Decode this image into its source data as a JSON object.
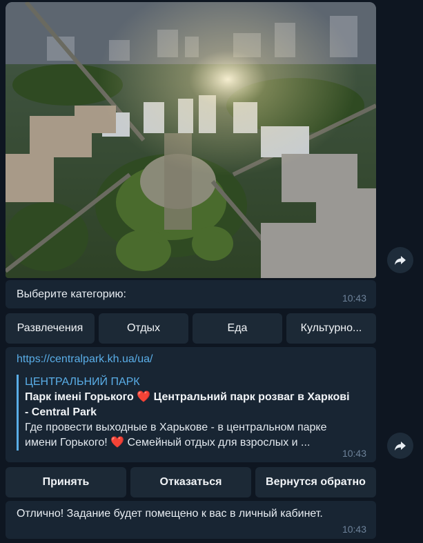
{
  "photo_message": {
    "alt_subject": "aerial city square"
  },
  "category_message": {
    "text": "Выберите категорию:",
    "time": "10:43"
  },
  "category_keyboard": [
    "Развлечения",
    "Отдых",
    "Еда",
    "Культурно..."
  ],
  "link_message": {
    "url": "https://centralpark.kh.ua/ua/",
    "preview_site": "ЦЕНТРАЛЬНИЙ ПАРК",
    "preview_title_a": "Парк імені Горького",
    "preview_title_b": "Центральний парк розваг в Харкові",
    "preview_title_c": "- Central Park",
    "preview_desc_a": "Где провести выходные в Харькове - в центральном парке",
    "preview_desc_b": "имени Горького!",
    "preview_desc_c": "Семейный отдых для взрослых и ...",
    "heart": "❤️",
    "time": "10:43"
  },
  "action_keyboard": [
    "Принять",
    "Отказаться",
    "Вернутся обратно"
  ],
  "confirm_message": {
    "text": "Отлично! Задание будет помещено к вас в личный кабинет.",
    "time": "10:43"
  },
  "icons": {
    "share": "share-arrow-icon"
  },
  "colors": {
    "background": "#0e1621",
    "bubble": "#182533",
    "button": "#1c2936",
    "link": "#5aaee8",
    "heart": "#e0293a"
  }
}
